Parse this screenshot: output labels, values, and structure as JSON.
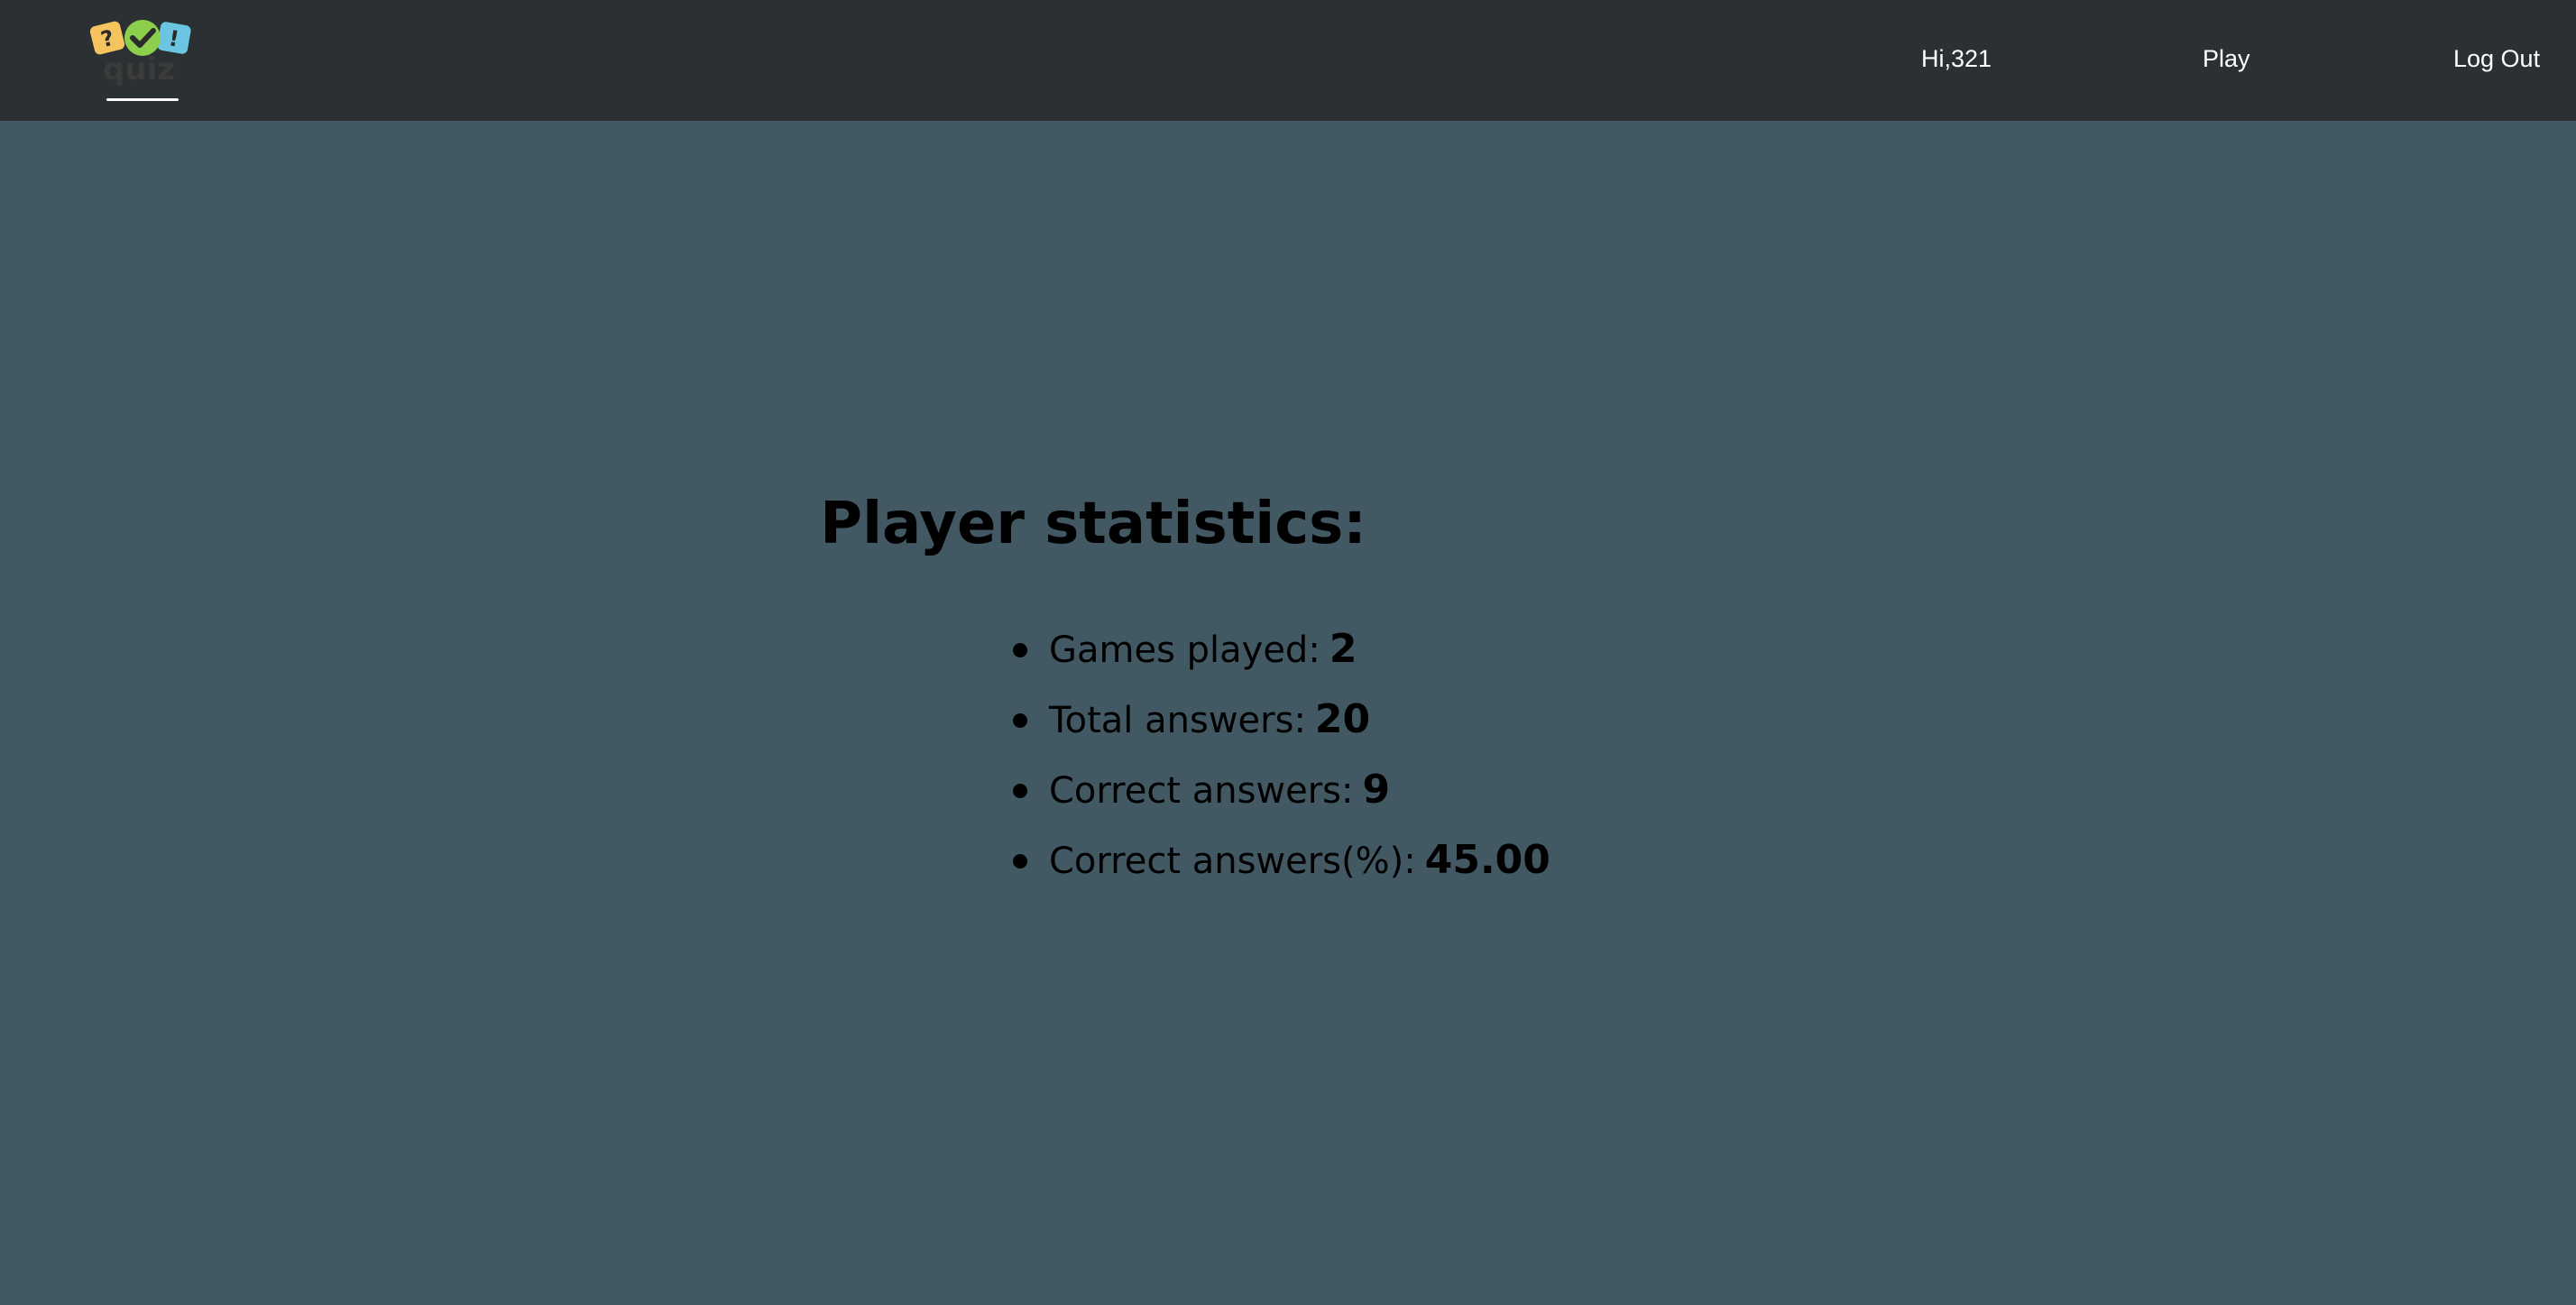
{
  "logo": {
    "text": "quiz",
    "badges": [
      "?",
      "✔",
      "!"
    ],
    "badge_colors": [
      "#f5c45e",
      "#8ccf4d",
      "#6cc5e0"
    ]
  },
  "nav": {
    "greeting": "Hi,321",
    "play_label": "Play",
    "logout_label": "Log Out"
  },
  "stats": {
    "title": "Player statistics:",
    "items": [
      {
        "label": "Games played:",
        "value": "2"
      },
      {
        "label": "Total answers:",
        "value": "20"
      },
      {
        "label": "Correct answers:",
        "value": "9"
      },
      {
        "label": "Correct answers(%):",
        "value": "45.00"
      }
    ]
  },
  "colors": {
    "navbar_bg": "#2b3033",
    "page_bg": "#425964",
    "nav_text": "#ffffff",
    "body_text": "#000000"
  }
}
